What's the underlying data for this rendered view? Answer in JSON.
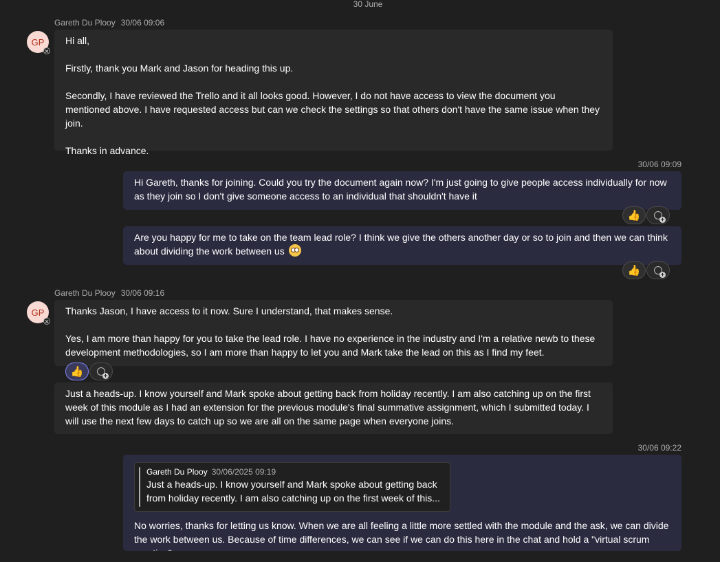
{
  "date_separator": "30 June",
  "messages": [
    {
      "author": "Gareth Du Plooy",
      "timestamp": "30/06 09:06",
      "avatar_initials": "GP",
      "paragraphs": [
        "Hi all,",
        "Firstly, thank you Mark and Jason for heading this up.",
        "Secondly, I have reviewed the Trello and it all looks good. However, I do not have access to view the document you mentioned above. I have requested access but can we check the settings so that others don't have the same issue when they join.",
        "Thanks in advance."
      ]
    },
    {
      "timestamp": "30/06 09:09",
      "text": "Hi Gareth, thanks for joining. Could you try the document again now? I'm just going to give people access individually for now as they join so I don't give someone access to an individual that shouldn't have it",
      "reaction": "👍"
    },
    {
      "text": "Are you happy for me to take on the team lead role? I think we give the others another day or so to join and then we can think about dividing the work between us",
      "reaction": "👍"
    },
    {
      "author": "Gareth Du Plooy",
      "timestamp": "30/06 09:16",
      "avatar_initials": "GP",
      "paragraphs": [
        "Thanks Jason, I have access to it now. Sure I understand, that makes sense.",
        "Yes, I am more than happy for you to take the lead role. I have no experience in the industry and I'm a relative newb to these development methodologies, so I am more than happy to let you and Mark take the lead on this as I find my feet."
      ],
      "reaction": "👍"
    },
    {
      "text": "Just a heads-up. I know yourself and Mark spoke about getting back from holiday recently. I am also catching up on the first week of this module as I had an extension for the previous module's final summative assignment, which I submitted today. I will use the next few days to catch up so we are all on the same page when everyone joins."
    },
    {
      "timestamp": "30/06 09:22",
      "quote": {
        "author": "Gareth Du Plooy",
        "timestamp": "30/06/2025 09:19",
        "text": "Just a heads-up. I know yourself and Mark spoke about getting back from holiday recently. I am also catching up on the first week of this..."
      },
      "text": "No worries, thanks for letting us know. When we are all feeling a little more settled with the module and the ask, we can divide the work between us. Because of time differences, we can see if we can do this here in the chat and hold a \"virtual scrum meeting\"."
    }
  ]
}
